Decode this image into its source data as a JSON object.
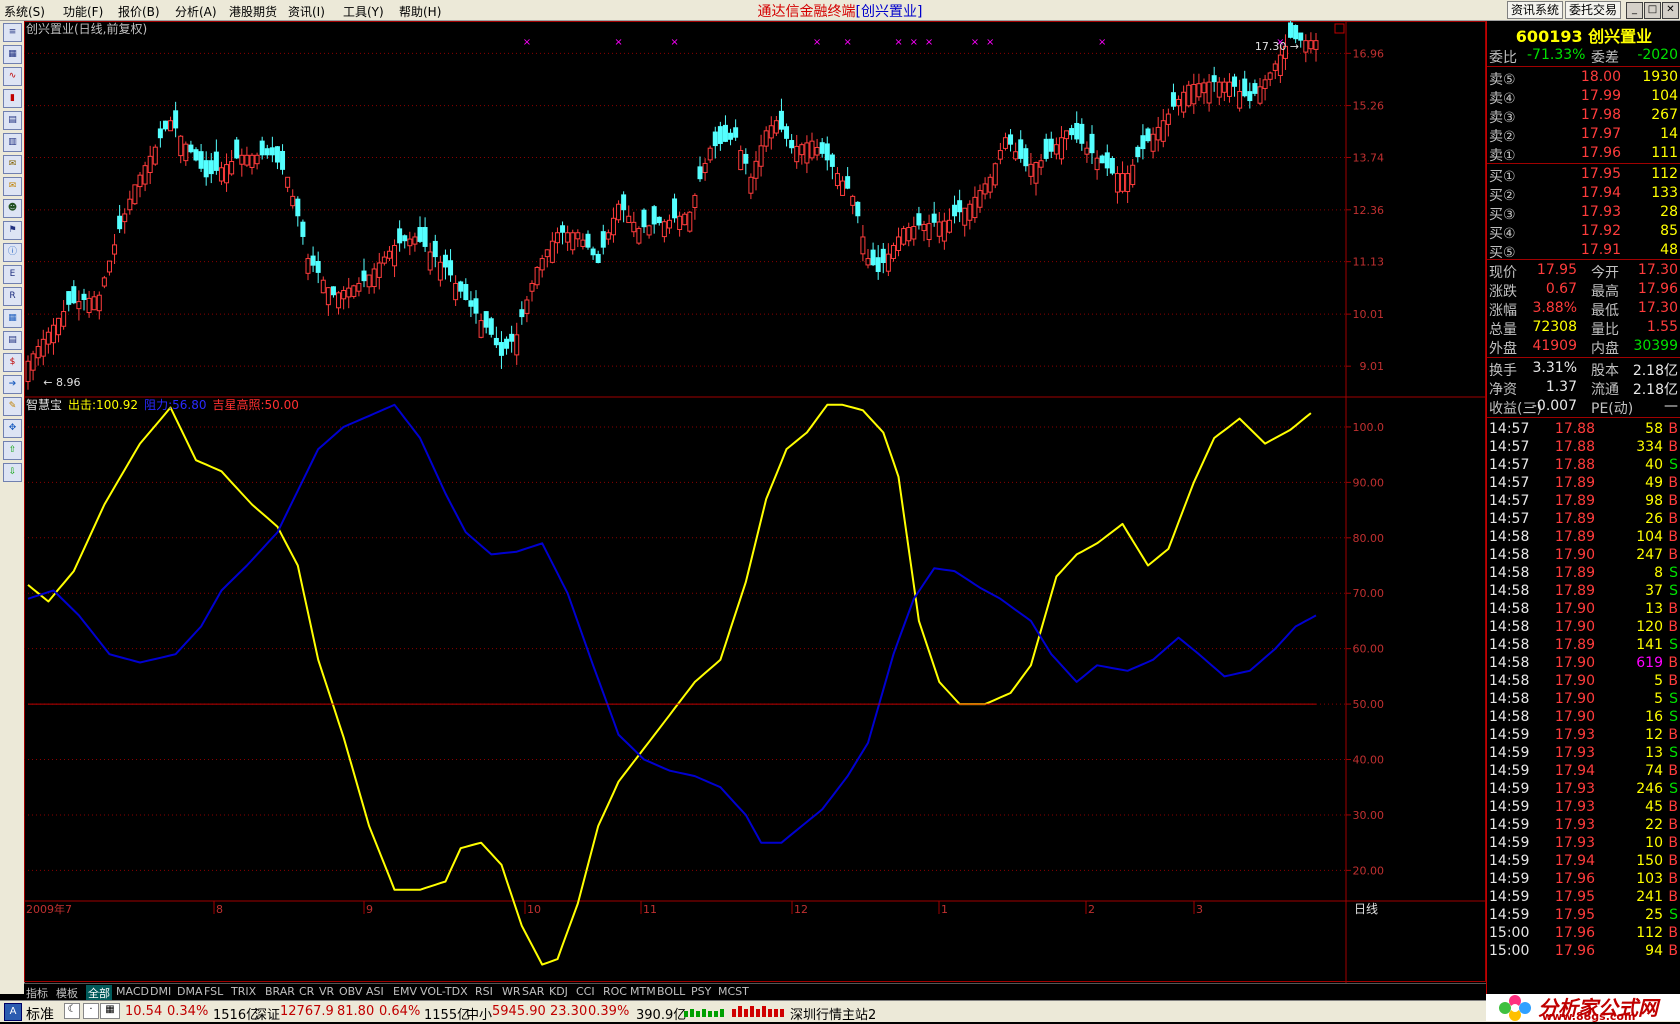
{
  "menu": [
    "系统(S)",
    "功能(F)",
    "报价(B)",
    "分析(A)",
    "港股期货",
    "资讯(I)",
    "工具(Y)",
    "帮助(H)"
  ],
  "title_prefix": "通达信金融终端",
  "title_stock": "[创兴置业]",
  "topright_buttons": [
    "资讯系统",
    "委托交易"
  ],
  "window_buttons": [
    "_",
    "□",
    "✕"
  ],
  "toolbar_icons": [
    "list-icon",
    "grid-icon",
    "line-chart-icon",
    "bar-chart-icon",
    "table-icon",
    "report-icon",
    "news-icon",
    "mail-icon",
    "people-icon",
    "fund-icon",
    "info-icon",
    "etf-icon",
    "rsi-icon",
    "tech-icon",
    "calc-icon",
    "money-icon",
    "export-icon",
    "pen-icon",
    "move-icon",
    "up-arrow-icon",
    "down-arrow-icon"
  ],
  "main_chart": {
    "label": "创兴置业(日线,前复权)",
    "y_ticks": [
      "16.96",
      "15.26",
      "13.74",
      "12.36",
      "11.13",
      "10.01",
      "9.01"
    ],
    "low_label": "← 8.96",
    "high_label": "17.30 →"
  },
  "indicator": {
    "name": "智慧宝",
    "line1_label": "出击:100.92",
    "line2_label": "阻力:56.80",
    "line3_label": "吉星高照:50.00",
    "colors": {
      "yellow": "#ffff00",
      "blue": "#0000d0",
      "red": "#c00000"
    },
    "y_ticks": [
      "100.0",
      "90.00",
      "80.00",
      "70.00",
      "60.00",
      "50.00",
      "40.00",
      "30.00",
      "20.00"
    ]
  },
  "x_labels": [
    "2009年7",
    "8",
    "9",
    "10",
    "11",
    "12",
    "1",
    "2",
    "3"
  ],
  "period_label": "日线",
  "tabs": [
    "指标",
    "模板",
    "全部",
    "MACD",
    "DMI",
    "DMA",
    "FSL",
    "TRIX",
    "BRAR",
    "CR",
    "VR",
    "OBV",
    "ASI",
    "EMV",
    "VOL-TDX",
    "RSI",
    "WR",
    "SAR",
    "KDJ",
    "CCI",
    "ROC",
    "MTM",
    "BOLL",
    "PSY",
    "MCST"
  ],
  "panel": {
    "code": "600193",
    "name": "创兴置业",
    "wb_label": "委比",
    "wb_value": "-71.33%",
    "wc_label": "委差",
    "wc_value": "-2020",
    "sells": [
      {
        "label": "卖⑤",
        "price": "18.00",
        "vol": "1930"
      },
      {
        "label": "卖④",
        "price": "17.99",
        "vol": "104"
      },
      {
        "label": "卖③",
        "price": "17.98",
        "vol": "267"
      },
      {
        "label": "卖②",
        "price": "17.97",
        "vol": "14"
      },
      {
        "label": "卖①",
        "price": "17.96",
        "vol": "111"
      }
    ],
    "buys": [
      {
        "label": "买①",
        "price": "17.95",
        "vol": "112"
      },
      {
        "label": "买②",
        "price": "17.94",
        "vol": "133"
      },
      {
        "label": "买③",
        "price": "17.93",
        "vol": "28"
      },
      {
        "label": "买④",
        "price": "17.92",
        "vol": "85"
      },
      {
        "label": "买⑤",
        "price": "17.91",
        "vol": "48"
      }
    ],
    "quote": [
      {
        "l1": "现价",
        "v1": "17.95",
        "c1": "red",
        "l2": "今开",
        "v2": "17.30",
        "c2": "red"
      },
      {
        "l1": "涨跌",
        "v1": "0.67",
        "c1": "red",
        "l2": "最高",
        "v2": "17.96",
        "c2": "red"
      },
      {
        "l1": "涨幅",
        "v1": "3.88%",
        "c1": "red",
        "l2": "最低",
        "v2": "17.30",
        "c2": "red"
      },
      {
        "l1": "总量",
        "v1": "72308",
        "c1": "yel",
        "l2": "量比",
        "v2": "1.55",
        "c2": "red"
      },
      {
        "l1": "外盘",
        "v1": "41909",
        "c1": "red",
        "l2": "内盘",
        "v2": "30399",
        "c2": "grn"
      }
    ],
    "fin": [
      {
        "l1": "换手",
        "v1": "3.31%",
        "l2": "股本",
        "v2": "2.18亿"
      },
      {
        "l1": "净资",
        "v1": "1.37",
        "l2": "流通",
        "v2": "2.18亿"
      },
      {
        "l1": "收益(三)",
        "v1": "-0.007",
        "l2": "PE(动)",
        "v2": "—"
      }
    ],
    "ticks": [
      [
        "14:57",
        "17.88",
        "58",
        "B"
      ],
      [
        "14:57",
        "17.88",
        "334",
        "B"
      ],
      [
        "14:57",
        "17.88",
        "40",
        "S"
      ],
      [
        "14:57",
        "17.89",
        "49",
        "B"
      ],
      [
        "14:57",
        "17.89",
        "98",
        "B"
      ],
      [
        "14:57",
        "17.89",
        "26",
        "B"
      ],
      [
        "14:58",
        "17.89",
        "104",
        "B"
      ],
      [
        "14:58",
        "17.90",
        "247",
        "B"
      ],
      [
        "14:58",
        "17.89",
        "8",
        "S"
      ],
      [
        "14:58",
        "17.89",
        "37",
        "S"
      ],
      [
        "14:58",
        "17.90",
        "13",
        "B"
      ],
      [
        "14:58",
        "17.90",
        "120",
        "B"
      ],
      [
        "14:58",
        "17.89",
        "141",
        "S"
      ],
      [
        "14:58",
        "17.90",
        "619",
        "B"
      ],
      [
        "14:58",
        "17.90",
        "5",
        "B"
      ],
      [
        "14:58",
        "17.90",
        "5",
        "S"
      ],
      [
        "14:58",
        "17.90",
        "16",
        "S"
      ],
      [
        "14:59",
        "17.93",
        "12",
        "B"
      ],
      [
        "14:59",
        "17.93",
        "13",
        "S"
      ],
      [
        "14:59",
        "17.94",
        "74",
        "B"
      ],
      [
        "14:59",
        "17.93",
        "246",
        "S"
      ],
      [
        "14:59",
        "17.93",
        "45",
        "B"
      ],
      [
        "14:59",
        "17.93",
        "22",
        "B"
      ],
      [
        "14:59",
        "17.93",
        "10",
        "B"
      ],
      [
        "14:59",
        "17.94",
        "150",
        "B"
      ],
      [
        "14:59",
        "17.96",
        "103",
        "B"
      ],
      [
        "14:59",
        "17.95",
        "241",
        "B"
      ],
      [
        "14:59",
        "17.95",
        "25",
        "S"
      ],
      [
        "15:00",
        "17.96",
        "112",
        "B"
      ],
      [
        "15:00",
        "17.96",
        "94",
        "B"
      ]
    ]
  },
  "status": {
    "mode": "标准",
    "sh_price": "10.54",
    "sh_pct": "0.34%",
    "sh_amt": "1516亿",
    "sz_label": "深证",
    "sz_val": "12767.9",
    "sz_chg": "81.80",
    "sz_pct": "0.64%",
    "sz_amt": "1155亿",
    "zx_label": "中小",
    "zx_val": "5945.90",
    "zx_chg": "23.30",
    "zx_pct": "0.39%",
    "zx_amt": "390.9亿",
    "server": "深圳行情主站2"
  },
  "logo": {
    "text": "分析家公式网",
    "url": "www.88gs.com"
  },
  "chart_data": [
    {
      "type": "candlestick",
      "title": "创兴置业(日线,前复权)",
      "x_labels": [
        "2009年7",
        "8",
        "9",
        "10",
        "11",
        "12",
        "1",
        "2",
        "3"
      ],
      "y_ticks": [
        9.01,
        10.01,
        11.13,
        12.36,
        13.74,
        15.26,
        16.96
      ],
      "ylim": [
        8.5,
        17.6
      ],
      "y_scale": "log",
      "waypoints_close": [
        [
          0,
          9.1
        ],
        [
          8,
          10.2
        ],
        [
          14,
          10.4
        ],
        [
          21,
          13.0
        ],
        [
          28,
          14.8
        ],
        [
          35,
          13.2
        ],
        [
          42,
          13.8
        ],
        [
          48,
          13.8
        ],
        [
          51,
          13.2
        ],
        [
          55,
          11.2
        ],
        [
          60,
          10.4
        ],
        [
          66,
          10.7
        ],
        [
          72,
          11.5
        ],
        [
          76,
          11.7
        ],
        [
          82,
          11.0
        ],
        [
          86,
          10.3
        ],
        [
          91,
          9.6
        ],
        [
          93,
          9.2
        ],
        [
          96,
          9.6
        ],
        [
          100,
          11.0
        ],
        [
          104,
          11.8
        ],
        [
          108,
          11.8
        ],
        [
          112,
          11.1
        ],
        [
          116,
          12.5
        ],
        [
          120,
          11.9
        ],
        [
          126,
          12.1
        ],
        [
          130,
          12.3
        ],
        [
          134,
          14.0
        ],
        [
          139,
          14.3
        ],
        [
          142,
          13.2
        ],
        [
          145,
          14.5
        ],
        [
          147,
          14.8
        ],
        [
          150,
          14.0
        ],
        [
          154,
          14.2
        ],
        [
          159,
          13.3
        ],
        [
          162,
          12.7
        ],
        [
          165,
          11.2
        ],
        [
          167,
          10.9
        ],
        [
          172,
          11.9
        ],
        [
          176,
          12.0
        ],
        [
          181,
          12.1
        ],
        [
          185,
          12.5
        ],
        [
          189,
          13.2
        ],
        [
          192,
          14.3
        ],
        [
          196,
          13.5
        ],
        [
          200,
          13.7
        ],
        [
          204,
          14.5
        ],
        [
          208,
          14.0
        ],
        [
          213,
          13.3
        ],
        [
          216,
          13.3
        ],
        [
          220,
          14.2
        ],
        [
          224,
          15.0
        ],
        [
          228,
          15.9
        ],
        [
          232,
          16.0
        ],
        [
          236,
          16.0
        ],
        [
          240,
          15.4
        ],
        [
          244,
          16.3
        ],
        [
          248,
          17.5
        ],
        [
          250,
          17.4
        ]
      ],
      "low": 8.96,
      "high": 17.3
    },
    {
      "type": "line",
      "title": "智慧宝",
      "y_ticks": [
        20,
        30,
        40,
        50,
        60,
        70,
        80,
        90,
        100
      ],
      "ylim": [
        17,
        104.5
      ],
      "series": [
        {
          "name": "出击",
          "color": "#ffff00",
          "last": 100.92,
          "points": [
            [
              0,
              71.5
            ],
            [
              4,
              68.5
            ],
            [
              9,
              74
            ],
            [
              15,
              86
            ],
            [
              22,
              97
            ],
            [
              28,
              103.5
            ],
            [
              33,
              94
            ],
            [
              38,
              92
            ],
            [
              44,
              86
            ],
            [
              49,
              82
            ],
            [
              53,
              75
            ],
            [
              57,
              58
            ],
            [
              62,
              44
            ],
            [
              67,
              28
            ],
            [
              72,
              16.5
            ],
            [
              77,
              16.5
            ],
            [
              82,
              18
            ],
            [
              85,
              24
            ],
            [
              89,
              25
            ],
            [
              93,
              21
            ],
            [
              97,
              10
            ],
            [
              101,
              3
            ],
            [
              104,
              4
            ],
            [
              108,
              14
            ],
            [
              112,
              28
            ],
            [
              116,
              36
            ],
            [
              121,
              42
            ],
            [
              126,
              48
            ],
            [
              131,
              54
            ],
            [
              136,
              58
            ],
            [
              141,
              72
            ],
            [
              145,
              87
            ],
            [
              149,
              96
            ],
            [
              153,
              99
            ],
            [
              157,
              104
            ],
            [
              160,
              104
            ],
            [
              164,
              103
            ],
            [
              168,
              99
            ],
            [
              171,
              91
            ],
            [
              175,
              65
            ],
            [
              179,
              54
            ],
            [
              183,
              50
            ],
            [
              188,
              50
            ],
            [
              193,
              52
            ],
            [
              197,
              57
            ],
            [
              202,
              73
            ],
            [
              206,
              77
            ],
            [
              210,
              79
            ],
            [
              215,
              82.5
            ],
            [
              220,
              75
            ],
            [
              224,
              78
            ],
            [
              229,
              90
            ],
            [
              233,
              98
            ],
            [
              238,
              101.5
            ],
            [
              243,
              97
            ],
            [
              248,
              99.5
            ],
            [
              252,
              102.5
            ]
          ]
        },
        {
          "name": "阻力",
          "color": "#0000d0",
          "last": 56.8,
          "points": [
            [
              0,
              69
            ],
            [
              5,
              70.5
            ],
            [
              10,
              66
            ],
            [
              16,
              59
            ],
            [
              22,
              57.5
            ],
            [
              29,
              59
            ],
            [
              34,
              64
            ],
            [
              38,
              70.5
            ],
            [
              43,
              75
            ],
            [
              49,
              81
            ],
            [
              53,
              88.5
            ],
            [
              57,
              96
            ],
            [
              62,
              100
            ],
            [
              67,
              102
            ],
            [
              72,
              104
            ],
            [
              77,
              98
            ],
            [
              82,
              88
            ],
            [
              86,
              81
            ],
            [
              91,
              77
            ],
            [
              96,
              77.5
            ],
            [
              101,
              79
            ],
            [
              106,
              70
            ],
            [
              111,
              57
            ],
            [
              116,
              44.5
            ],
            [
              121,
              40
            ],
            [
              126,
              38
            ],
            [
              131,
              37
            ],
            [
              136,
              35
            ],
            [
              141,
              30
            ],
            [
              144,
              25
            ],
            [
              148,
              25
            ],
            [
              152,
              28
            ],
            [
              156,
              31
            ],
            [
              161,
              37
            ],
            [
              165,
              43
            ],
            [
              170,
              59
            ],
            [
              174,
              69
            ],
            [
              178,
              74.5
            ],
            [
              182,
              74
            ],
            [
              187,
              71
            ],
            [
              191,
              69
            ],
            [
              197,
              65
            ],
            [
              201,
              59
            ],
            [
              206,
              54
            ],
            [
              210,
              57
            ],
            [
              216,
              56
            ],
            [
              221,
              58
            ],
            [
              226,
              62
            ],
            [
              230,
              59
            ],
            [
              235,
              55
            ],
            [
              240,
              56
            ],
            [
              245,
              60
            ],
            [
              249,
              64
            ],
            [
              253,
              66
            ]
          ]
        },
        {
          "name": "吉星高照",
          "color": "#c00000",
          "last": 50.0,
          "points": [
            [
              0,
              50
            ],
            [
              253,
              50
            ]
          ]
        }
      ]
    }
  ]
}
